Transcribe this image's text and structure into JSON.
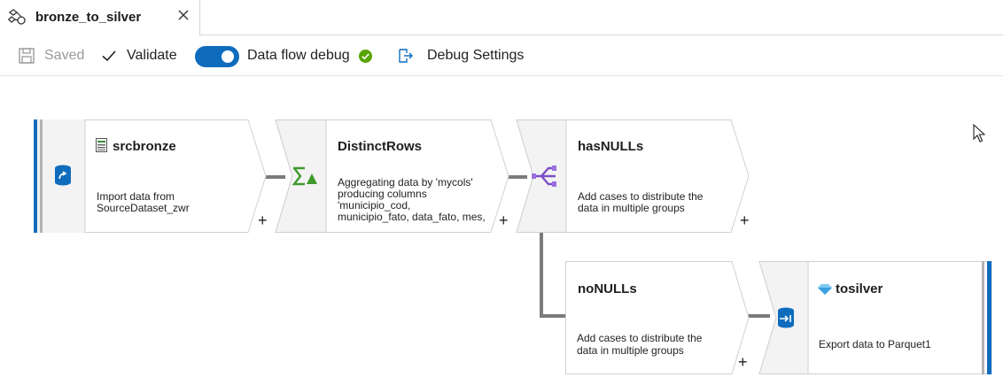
{
  "tab": {
    "title": "bronze_to_silver",
    "icon": "dataflow-icon"
  },
  "toolbar": {
    "saved_label": "Saved",
    "validate_label": "Validate",
    "debug_label": "Data flow debug",
    "debug_on": true,
    "debug_settings_label": "Debug Settings"
  },
  "nodes": {
    "source": {
      "title": "srcbronze",
      "desc1": "Import data from",
      "desc2": "SourceDataset_zwr",
      "icon": "source-icon"
    },
    "distinct": {
      "title": "DistinctRows",
      "desc1": "Aggregating data by 'mycols'",
      "desc2": "producing columns",
      "desc3": "'municipio_cod,",
      "desc4": "municipio_fato, data_fato, mes,",
      "icon": "aggregate-icon"
    },
    "hasnulls": {
      "title": "hasNULLs",
      "desc1": "Add cases to distribute the",
      "desc2": "data in multiple groups",
      "icon": "split-icon"
    },
    "nonulls": {
      "title": "noNULLs",
      "desc1": "Add cases to distribute the",
      "desc2": "data in multiple groups"
    },
    "sink": {
      "title": "tosilver",
      "desc1": "Export data to Parquet1",
      "icon": "sink-icon"
    }
  },
  "plus_label": "+",
  "colors": {
    "accent": "#0f6cbd",
    "success": "#57a300",
    "connector": "#7b7b7b"
  }
}
